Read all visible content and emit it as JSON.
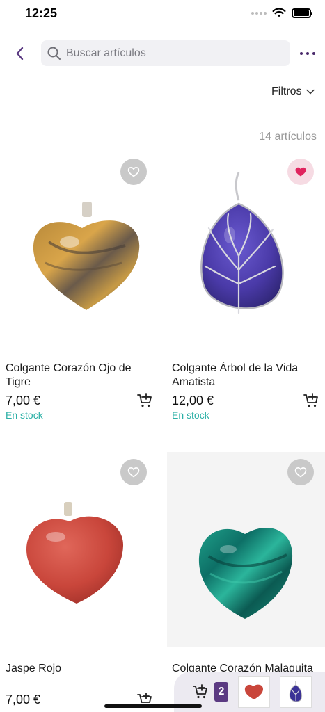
{
  "status_bar": {
    "time": "12:25"
  },
  "search": {
    "placeholder": "Buscar artículos"
  },
  "filters": {
    "label": "Filtros"
  },
  "results": {
    "count_label": "14 artículos"
  },
  "products": [
    {
      "name": "Colgante Corazón Ojo de Tigre",
      "price": "7,00 €",
      "stock": "En stock",
      "favorite": false,
      "image": "tiger-eye-heart-pendant"
    },
    {
      "name": "Colgante Árbol de la Vida Amatista",
      "price": "12,00 €",
      "stock": "En stock",
      "favorite": true,
      "image": "amethyst-tree-of-life-pendant"
    },
    {
      "name": "Jaspe Rojo",
      "price": "7,00 €",
      "stock": "",
      "favorite": false,
      "image": "red-jasper-heart-pendant"
    },
    {
      "name": "Colgante Corazón Malaquita",
      "price": "",
      "stock": "",
      "favorite": false,
      "image": "malachite-heart-pendant"
    }
  ],
  "mini_cart": {
    "count": "2"
  },
  "colors": {
    "accent": "#5b3a82",
    "stock": "#2bb0a6",
    "favorite": "#e0245e"
  }
}
